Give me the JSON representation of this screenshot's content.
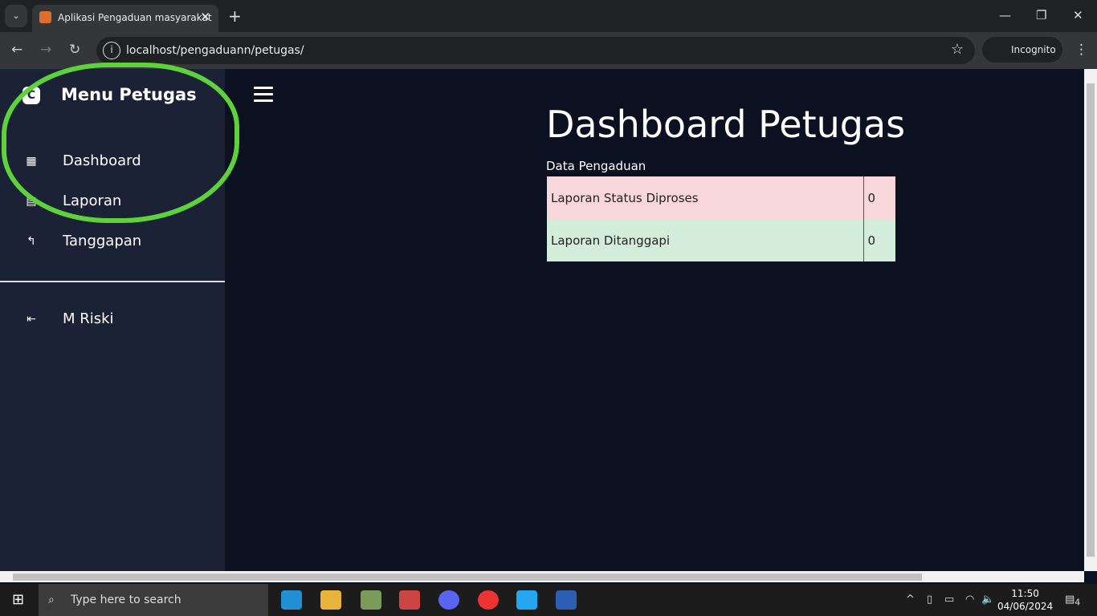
{
  "browser": {
    "tab_title": "Aplikasi Pengaduan masyarakat",
    "url": "localhost/pengaduann/petugas/",
    "incognito": "Incognito"
  },
  "sidebar": {
    "brand": "Menu Petugas",
    "items": [
      {
        "label": "Dashboard",
        "icon": "dashboard-icon"
      },
      {
        "label": "Laporan",
        "icon": "report-icon"
      },
      {
        "label": "Tanggapan",
        "icon": "reply-icon"
      }
    ],
    "user": "M Riski"
  },
  "main": {
    "title": "Dashboard Petugas",
    "section": "Data Pengaduan",
    "rows": [
      {
        "label": "Laporan Status Diproses",
        "value": "0",
        "color": "#f8d7da"
      },
      {
        "label": "Laporan Ditanggapi",
        "value": "0",
        "color": "#d4edda"
      }
    ]
  },
  "taskbar": {
    "search_placeholder": "Type here to search",
    "time": "11:50",
    "date": "04/06/2024",
    "notifications": "4"
  }
}
